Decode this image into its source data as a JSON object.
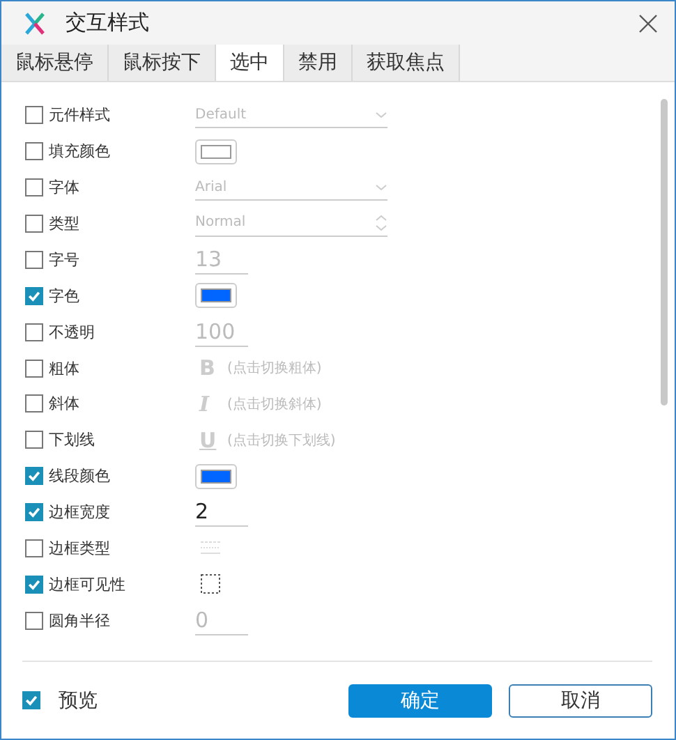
{
  "window": {
    "title": "交互样式"
  },
  "tabs": [
    {
      "label": "鼠标悬停",
      "selected": false
    },
    {
      "label": "鼠标按下",
      "selected": false
    },
    {
      "label": "选中",
      "selected": true
    },
    {
      "label": "禁用",
      "selected": false
    },
    {
      "label": "获取焦点",
      "selected": false
    }
  ],
  "properties": [
    {
      "label": "元件样式",
      "checked": false,
      "kind": "select",
      "value": "Default"
    },
    {
      "label": "填充颜色",
      "checked": false,
      "kind": "color",
      "color": "#ffffff"
    },
    {
      "label": "字体",
      "checked": false,
      "kind": "select",
      "value": "Arial"
    },
    {
      "label": "类型",
      "checked": false,
      "kind": "spinner",
      "value": "Normal"
    },
    {
      "label": "字号",
      "checked": false,
      "kind": "number",
      "value": "13"
    },
    {
      "label": "字色",
      "checked": true,
      "kind": "color",
      "color": "#0066ff"
    },
    {
      "label": "不透明",
      "checked": false,
      "kind": "number",
      "value": "100"
    },
    {
      "label": "粗体",
      "checked": false,
      "kind": "toggle",
      "glyph": "B",
      "hint": "(点击切换粗体)"
    },
    {
      "label": "斜体",
      "checked": false,
      "kind": "toggle",
      "glyph": "I",
      "hint": "(点击切换斜体)"
    },
    {
      "label": "下划线",
      "checked": false,
      "kind": "toggle",
      "glyph": "U",
      "hint": "(点击切换下划线)"
    },
    {
      "label": "线段颜色",
      "checked": true,
      "kind": "color",
      "color": "#0066ff"
    },
    {
      "label": "边框宽度",
      "checked": true,
      "kind": "number",
      "value": "2"
    },
    {
      "label": "边框类型",
      "checked": false,
      "kind": "linestyle"
    },
    {
      "label": "边框可见性",
      "checked": true,
      "kind": "borders"
    },
    {
      "label": "圆角半径",
      "checked": false,
      "kind": "number",
      "value": "0"
    }
  ],
  "preview": {
    "label": "预览",
    "checked": true
  },
  "buttons": [
    {
      "label": "确定",
      "kind": "primary"
    },
    {
      "label": "取消",
      "kind": "secondary"
    }
  ]
}
